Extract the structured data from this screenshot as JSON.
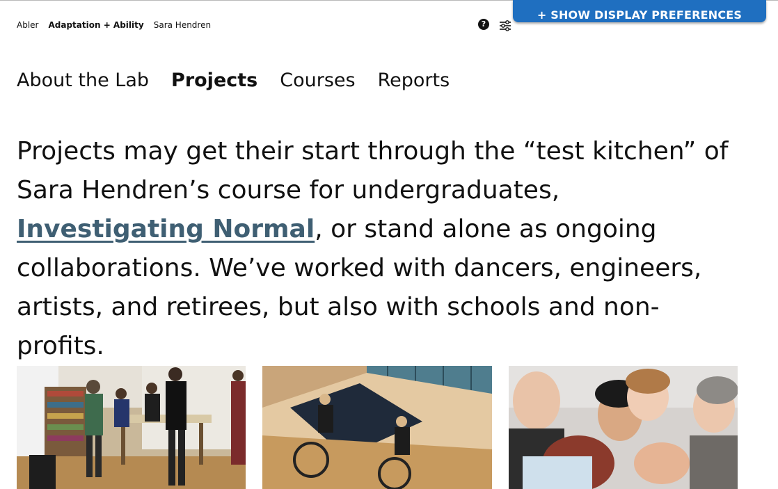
{
  "display_prefs": {
    "label": "+ SHOW DISPLAY PREFERENCES"
  },
  "breadcrumb": {
    "items": [
      "Abler",
      "Adaptation + Ability",
      "Sara Hendren"
    ]
  },
  "header_icons": {
    "help": "?",
    "help_icon": "question-circle-icon",
    "settings_icon": "sliders-icon"
  },
  "nav": {
    "items": [
      {
        "label": "About the Lab",
        "active": false
      },
      {
        "label": "Projects",
        "active": true
      },
      {
        "label": "Courses",
        "active": false
      },
      {
        "label": "Reports",
        "active": false
      }
    ]
  },
  "intro": {
    "before_link": "Projects may get their start through the “test kitchen” of Sara Hendren’s course for undergraduates, ",
    "link_text": "Investigating Normal",
    "after_link": ", or stand alone as ongoing collaborations. We’ve worked with dancers, engineers, artists, and retirees, but also with schools and non-profits."
  },
  "colors": {
    "prefs_tab_bg": "#1f6fc0",
    "link": "#3f5f73",
    "text": "#111111"
  }
}
